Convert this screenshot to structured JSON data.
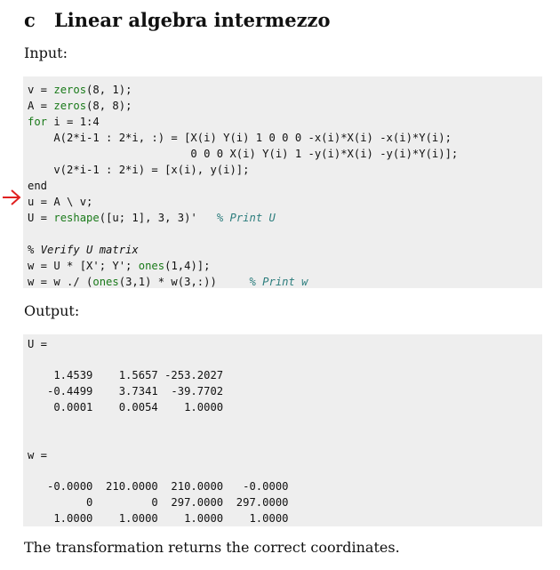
{
  "section": {
    "number": "c",
    "title": "Linear algebra intermezzo"
  },
  "input_label": "Input:",
  "code": {
    "line1": {
      "a": "v = ",
      "fn": "zeros",
      "b": "(8, 1);"
    },
    "line2": {
      "a": "A = ",
      "fn": "zeros",
      "b": "(8, 8);"
    },
    "line3": {
      "kw": "for",
      "b": " i = 1:4"
    },
    "line4": "    A(2*i-1 : 2*i, :) = [X(i) Y(i) 1 0 0 0 -x(i)*X(i) -x(i)*Y(i);",
    "line5": "                         0 0 0 X(i) Y(i) 1 -y(i)*X(i) -y(i)*Y(i)];",
    "line6": "    v(2*i-1 : 2*i) = [x(i), y(i)];",
    "line7": "end",
    "line8": "u = A \\ v;",
    "line9": {
      "a": "U = ",
      "fn": "reshape",
      "b": "([u; 1], 3, 3)'   ",
      "cm": "% Print U"
    },
    "line10": "% Verify U matrix",
    "line11": {
      "a": "w = U * [X'; Y'; ",
      "fn": "ones",
      "b": "(1,4)];"
    },
    "line12": {
      "a": "w = w ./ (",
      "fn": "ones",
      "b": "(3,1) * w(3,:))     ",
      "cm": "% Print w"
    }
  },
  "output_label": "Output:",
  "output": {
    "u_header": "U =",
    "u_rows": [
      "    1.4539    1.5657 -253.2027",
      "   -0.4499    3.7341  -39.7702",
      "    0.0001    0.0054    1.0000"
    ],
    "w_header": "w =",
    "w_rows": [
      "   -0.0000  210.0000  210.0000   -0.0000",
      "         0         0  297.0000  297.0000",
      "    1.0000    1.0000    1.0000    1.0000"
    ]
  },
  "footer_text": "The transformation returns the correct coordinates.",
  "colors": {
    "arrow": "#e02020",
    "code_background": "#eeeeee",
    "function_green": "#1a7a1a",
    "comment_teal": "#2c7d7d"
  },
  "icons": {
    "annotation_arrow": "red-right-arrow"
  }
}
